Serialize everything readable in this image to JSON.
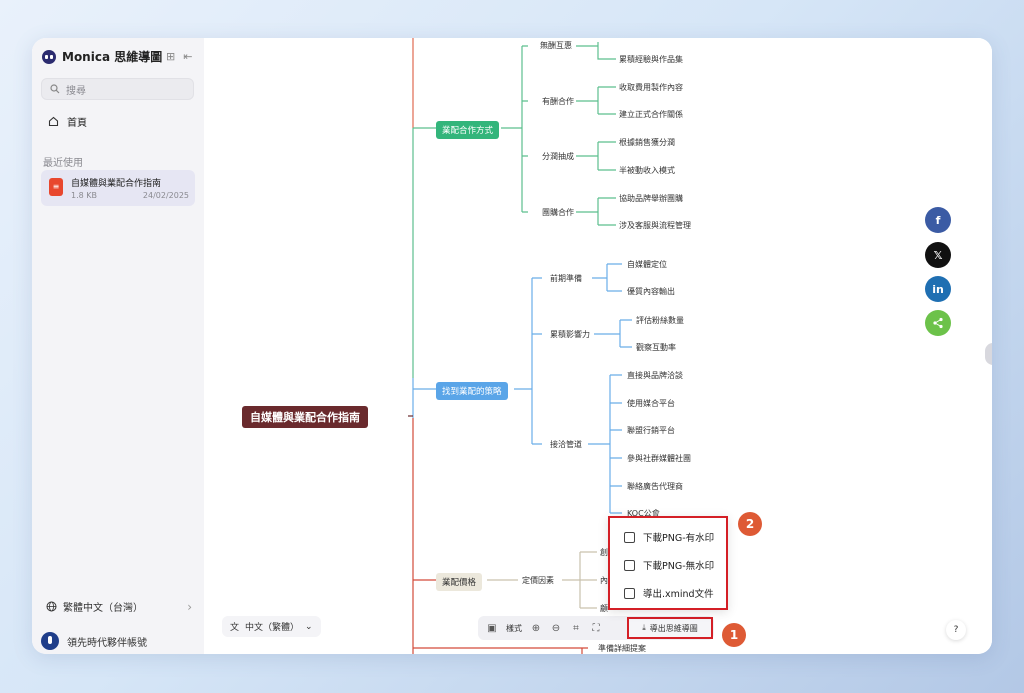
{
  "sidebar": {
    "brand": "Monica 思維導圖",
    "search_placeholder": "搜尋",
    "home": "首頁",
    "recent_label": "最近使用",
    "recent_file": {
      "name": "自媒體與業配合作指南",
      "size": "1.8 KB",
      "date": "24/02/2025"
    },
    "language": "繁體中文（台灣）",
    "user": "領先時代夥伴帳號"
  },
  "mindmap": {
    "root": "自媒體與業配合作指南",
    "branches": {
      "coop": {
        "label": "業配合作方式",
        "subs": [
          {
            "label": "無酬互惠",
            "leaves": [
              "累積經驗與作品集"
            ]
          },
          {
            "label": "有酬合作",
            "leaves": [
              "收取費用製作內容",
              "建立正式合作關係"
            ]
          },
          {
            "label": "分潤抽成",
            "leaves": [
              "根據銷售獲分潤",
              "半被動收入模式"
            ]
          },
          {
            "label": "團購合作",
            "leaves": [
              "協助品牌舉辦團購",
              "涉及客服與流程管理"
            ]
          }
        ]
      },
      "strategy": {
        "label": "找到業配的策略",
        "subs": [
          {
            "label": "前期準備",
            "leaves": [
              "自媒體定位",
              "優質內容輸出"
            ]
          },
          {
            "label": "累積影響力",
            "leaves": [
              "評估粉絲數量",
              "觀察互動率"
            ]
          },
          {
            "label": "接洽管道",
            "leaves": [
              "直接與品牌洽談",
              "使用媒合平台",
              "聯盟行銷平台",
              "參與社群媒體社團",
              "聯絡廣告代理商",
              "KOC公會"
            ]
          }
        ]
      },
      "price": {
        "label": "業配價格",
        "subs": [
          {
            "label": "定價因素",
            "leaves": [
              "創",
              "內",
              "顧"
            ]
          }
        ],
        "next": "準備詳細提案"
      }
    }
  },
  "bottom": {
    "lang_select": "中文（繁體）",
    "style_btn": "樣式",
    "export_btn": "導出思維導圖"
  },
  "export_menu": [
    "下載PNG-有水印",
    "下載PNG-無水印",
    "導出.xmind文件"
  ],
  "badges": [
    "1",
    "2"
  ],
  "share": {
    "facebook": "f",
    "x": "𝕏",
    "linkedin": "in",
    "help": "?"
  },
  "colors": {
    "accent": "#d41f26",
    "green": "#33b57b",
    "blue": "#5aa5e8",
    "root": "#6a2a2d",
    "badge": "#de5a35"
  }
}
